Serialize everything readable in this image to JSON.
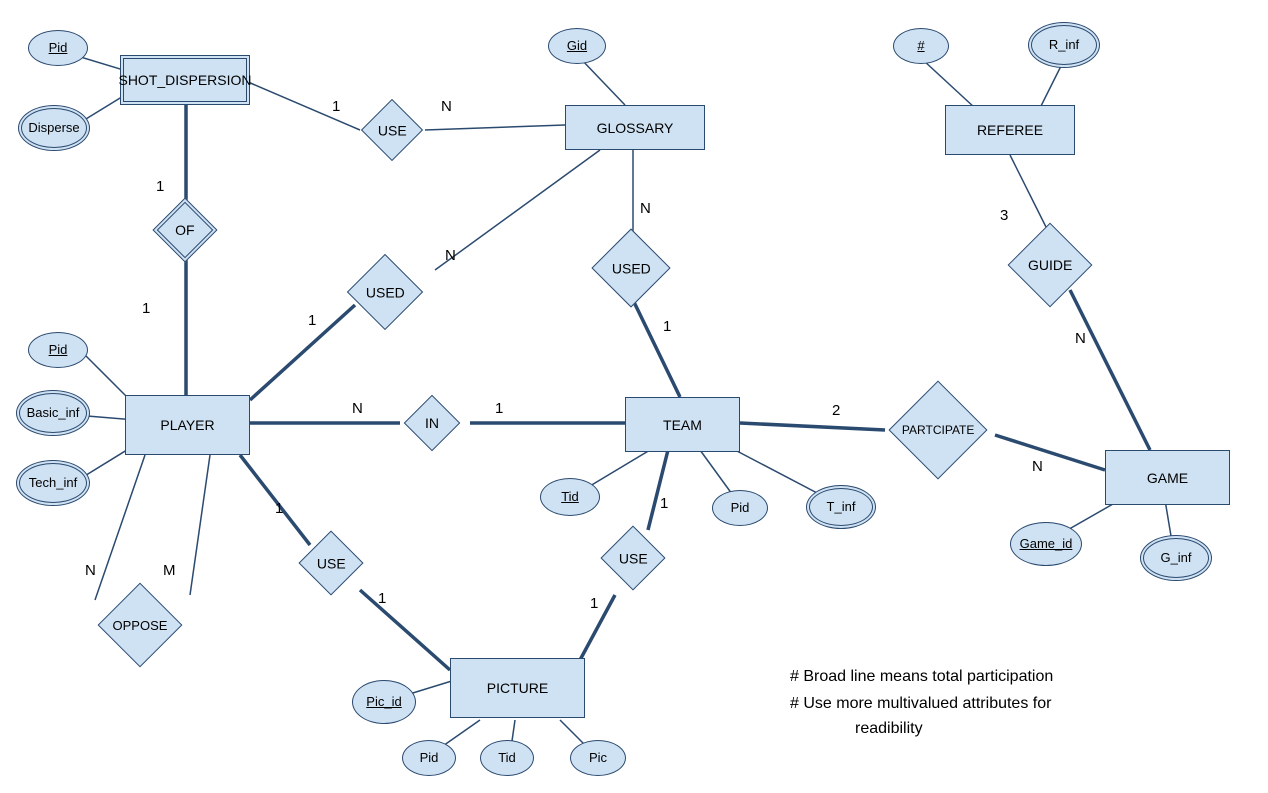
{
  "entities": {
    "shot_dispersion": "SHOT_DISPERSION",
    "glossary": "GLOSSARY",
    "referee": "REFEREE",
    "player": "PLAYER",
    "team": "TEAM",
    "game": "GAME",
    "picture": "PICTURE"
  },
  "relationships": {
    "use_sd_gl": "USE",
    "of": "OF",
    "used_pl_gl": "USED",
    "used_tm_gl": "USED",
    "guide": "GUIDE",
    "in": "IN",
    "participate": "PARTCIPATE",
    "oppose": "OPPOSE",
    "use_pl_pic": "USE",
    "use_tm_pic": "USE"
  },
  "attributes": {
    "sd_pid": "Pid",
    "sd_disperse": "Disperse",
    "gl_gid": "Gid",
    "ref_num": "#",
    "ref_inf": "R_inf",
    "pl_pid": "Pid",
    "pl_basic": "Basic_inf",
    "pl_tech": "Tech_inf",
    "tm_tid": "Tid",
    "tm_pid": "Pid",
    "tm_tinf": "T_inf",
    "gm_id": "Game_id",
    "gm_inf": "G_inf",
    "pic_id": "Pic_id",
    "pic_pid": "Pid",
    "pic_tid": "Tid",
    "pic_pic": "Pic"
  },
  "cardinalities": {
    "use_sd": "1",
    "use_gl": "N",
    "of_sd": "1",
    "of_pl": "1",
    "used_pl": "1",
    "used_pl_gl": "N",
    "used_tm_gl": "N",
    "used_tm": "1",
    "in_pl": "N",
    "in_tm": "1",
    "part_tm": "2",
    "part_gm": "N",
    "guide_rf": "3",
    "guide_gm": "N",
    "opp_n": "N",
    "opp_m": "M",
    "use_plpic_pl": "1",
    "use_plpic_pic": "1",
    "use_tmpic_tm": "1",
    "use_tmpic_pic": "1"
  },
  "notes": {
    "n1": "# Broad line means  total participation",
    "n2": "# Use more multivalued attributes for",
    "n3": "readibility"
  },
  "chart_data": {
    "type": "diagram",
    "subtype": "er-diagram",
    "entities": [
      {
        "name": "SHOT_DISPERSION",
        "weak": true,
        "attributes": [
          {
            "name": "Pid",
            "key": true
          },
          {
            "name": "Disperse",
            "multivalued": true
          }
        ]
      },
      {
        "name": "GLOSSARY",
        "attributes": [
          {
            "name": "Gid",
            "key": true
          }
        ]
      },
      {
        "name": "REFEREE",
        "attributes": [
          {
            "name": "#",
            "key": true
          },
          {
            "name": "R_inf",
            "multivalued": true
          }
        ]
      },
      {
        "name": "PLAYER",
        "attributes": [
          {
            "name": "Pid",
            "key": true
          },
          {
            "name": "Basic_inf",
            "multivalued": true
          },
          {
            "name": "Tech_inf",
            "multivalued": true
          }
        ]
      },
      {
        "name": "TEAM",
        "attributes": [
          {
            "name": "Tid",
            "key": true
          },
          {
            "name": "Pid"
          },
          {
            "name": "T_inf",
            "multivalued": true
          }
        ]
      },
      {
        "name": "GAME",
        "attributes": [
          {
            "name": "Game_id",
            "key": true
          },
          {
            "name": "G_inf",
            "multivalued": true
          }
        ]
      },
      {
        "name": "PICTURE",
        "attributes": [
          {
            "name": "Pic_id",
            "key": true
          },
          {
            "name": "Pid"
          },
          {
            "name": "Tid"
          },
          {
            "name": "Pic"
          }
        ]
      }
    ],
    "relationships": [
      {
        "name": "USE",
        "between": [
          "SHOT_DISPERSION",
          "GLOSSARY"
        ],
        "card": [
          "1",
          "N"
        ]
      },
      {
        "name": "OF",
        "identifying": true,
        "between": [
          "SHOT_DISPERSION",
          "PLAYER"
        ],
        "card": [
          "1",
          "1"
        ],
        "total": [
          "SHOT_DISPERSION",
          "PLAYER"
        ]
      },
      {
        "name": "USED",
        "between": [
          "PLAYER",
          "GLOSSARY"
        ],
        "card": [
          "1",
          "N"
        ],
        "total": [
          "PLAYER"
        ]
      },
      {
        "name": "USED",
        "between": [
          "TEAM",
          "GLOSSARY"
        ],
        "card": [
          "1",
          "N"
        ],
        "total": [
          "TEAM"
        ]
      },
      {
        "name": "IN",
        "between": [
          "PLAYER",
          "TEAM"
        ],
        "card": [
          "N",
          "1"
        ],
        "total": [
          "PLAYER",
          "TEAM"
        ]
      },
      {
        "name": "PARTCIPATE",
        "between": [
          "TEAM",
          "GAME"
        ],
        "card": [
          "2",
          "N"
        ],
        "total": [
          "TEAM",
          "GAME"
        ]
      },
      {
        "name": "GUIDE",
        "between": [
          "REFEREE",
          "GAME"
        ],
        "card": [
          "3",
          "N"
        ],
        "total": [
          "GAME"
        ]
      },
      {
        "name": "OPPOSE",
        "between": [
          "PLAYER",
          "PLAYER"
        ],
        "card": [
          "N",
          "M"
        ]
      },
      {
        "name": "USE",
        "between": [
          "PLAYER",
          "PICTURE"
        ],
        "card": [
          "1",
          "1"
        ],
        "total": [
          "PICTURE"
        ]
      },
      {
        "name": "USE",
        "between": [
          "TEAM",
          "PICTURE"
        ],
        "card": [
          "1",
          "1"
        ],
        "total": [
          "PICTURE"
        ]
      }
    ],
    "legend": [
      "Broad line means total participation",
      "Use more multivalued attributes for readibility"
    ]
  }
}
